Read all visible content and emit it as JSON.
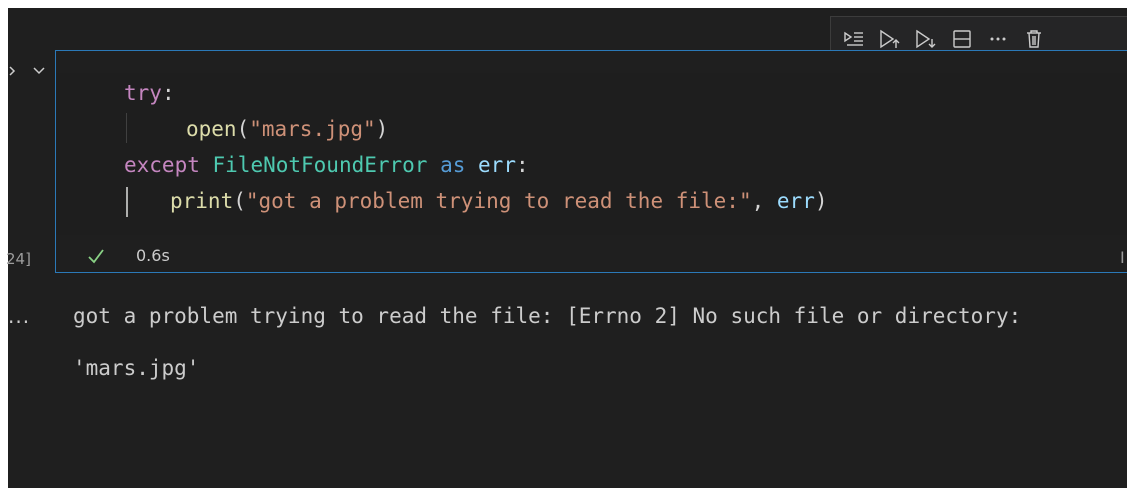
{
  "toolbar": {
    "buttons": [
      {
        "icon": "run-by-line-icon"
      },
      {
        "icon": "execute-above-icon"
      },
      {
        "icon": "execute-below-icon"
      },
      {
        "icon": "split-cell-icon"
      },
      {
        "icon": "more-actions-icon"
      },
      {
        "icon": "delete-cell-icon"
      }
    ]
  },
  "cell": {
    "code_lines": [
      [
        {
          "t": "try",
          "c": "kw"
        },
        {
          "t": ":",
          "c": "plain"
        }
      ],
      [
        {
          "t": "open",
          "c": "fn"
        },
        {
          "t": "(",
          "c": "plain"
        },
        {
          "t": "\"mars.jpg\"",
          "c": "str"
        },
        {
          "t": ")",
          "c": "plain"
        }
      ],
      [
        {
          "t": "except ",
          "c": "kw"
        },
        {
          "t": "FileNotFoundError",
          "c": "cls"
        },
        {
          "t": " as ",
          "c": "kw2"
        },
        {
          "t": "err",
          "c": "var"
        },
        {
          "t": ":",
          "c": "plain"
        }
      ],
      [
        {
          "t": "print",
          "c": "fn"
        },
        {
          "t": "(",
          "c": "plain"
        },
        {
          "t": "\"got a problem trying to read the file:\"",
          "c": "str"
        },
        {
          "t": ", ",
          "c": "plain"
        },
        {
          "t": "err",
          "c": "var"
        },
        {
          "t": ")",
          "c": "plain"
        }
      ]
    ],
    "execution_count": "24]",
    "exec_time": "0.6s",
    "status": "success",
    "right_marker": "I"
  },
  "output": {
    "indicator": "...",
    "text": "got a problem trying to read the file: [Errno 2] No such file or directory: 'mars.jpg'"
  },
  "colors": {
    "accent_border": "#2b79b8",
    "success_check": "#89d185",
    "background": "#1f1f1f"
  }
}
